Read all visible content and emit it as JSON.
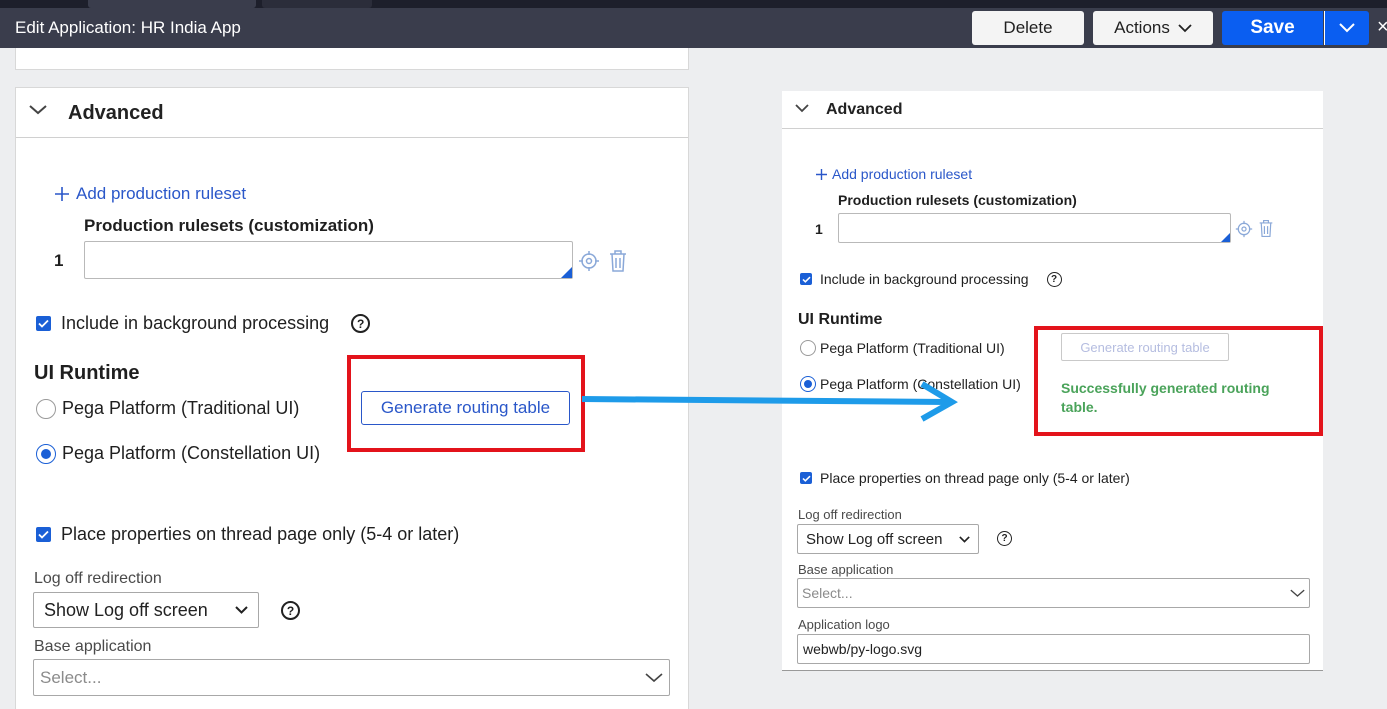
{
  "header": {
    "title": "Edit  Application: HR India App",
    "delete_label": "Delete",
    "actions_label": "Actions",
    "save_label": "Save"
  },
  "left": {
    "section_title": "Advanced",
    "add_ruleset": "Add production ruleset",
    "rulesets_label": "Production rulesets (customization)",
    "row_number": "1",
    "include_bg": "Include in background processing",
    "help_glyph": "?",
    "runtime_title": "UI Runtime",
    "radio_traditional": "Pega Platform (Traditional UI)",
    "radio_constellation": "Pega Platform (Constellation UI)",
    "generate_button": "Generate routing table",
    "thread_page": "Place properties on thread page only (5-4 or later)",
    "logoff_label": "Log off redirection",
    "logoff_value": "Show Log off screen",
    "base_label": "Base application",
    "base_placeholder": "Select..."
  },
  "right": {
    "section_title": "Advanced",
    "add_ruleset": "Add production ruleset",
    "rulesets_label": "Production rulesets (customization)",
    "row_number": "1",
    "include_bg": "Include in background processing",
    "help_glyph": "?",
    "runtime_title": "UI Runtime",
    "radio_traditional": "Pega Platform (Traditional UI)",
    "radio_constellation": "Pega Platform (Constellation UI)",
    "generate_button": "Generate routing table",
    "success_message": "Successfully generated routing table.",
    "thread_page": "Place properties on thread page only (5-4 or later)",
    "logoff_label": "Log off redirection",
    "logoff_value": "Show Log off screen",
    "base_label": "Base application",
    "base_placeholder": "Select...",
    "logo_label": "Application logo",
    "logo_value": "webwb/py-logo.svg"
  },
  "colors": {
    "header": "#3a3d4c",
    "save": "#0a5ef1",
    "link": "#2a57c9",
    "highlight": "#e3131b",
    "success": "#4aa35a",
    "arrow": "#1e9be9"
  }
}
